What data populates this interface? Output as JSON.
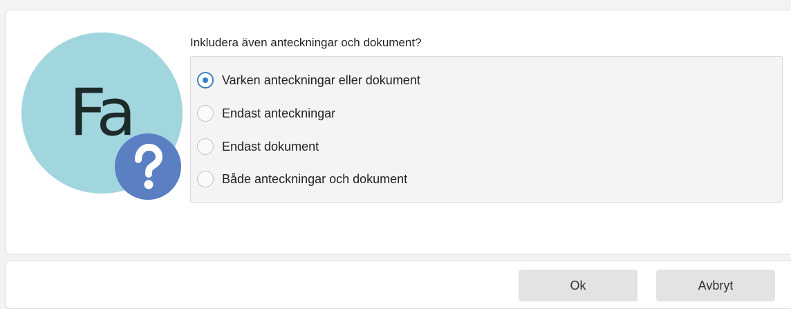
{
  "dialog": {
    "avatar": {
      "initials": "Fa",
      "background_color": "#a2d6df",
      "badge_icon": "question-mark-icon",
      "badge_color": "#5b7fc3"
    },
    "question": "Inkludera även anteckningar och dokument?",
    "options": [
      {
        "label": "Varken anteckningar eller dokument",
        "selected": true
      },
      {
        "label": "Endast anteckningar",
        "selected": false
      },
      {
        "label": "Endast dokument",
        "selected": false
      },
      {
        "label": "Både anteckningar och dokument",
        "selected": false
      }
    ],
    "accent_color": "#3c7fc8"
  },
  "footer": {
    "ok_label": "Ok",
    "cancel_label": "Avbryt"
  }
}
